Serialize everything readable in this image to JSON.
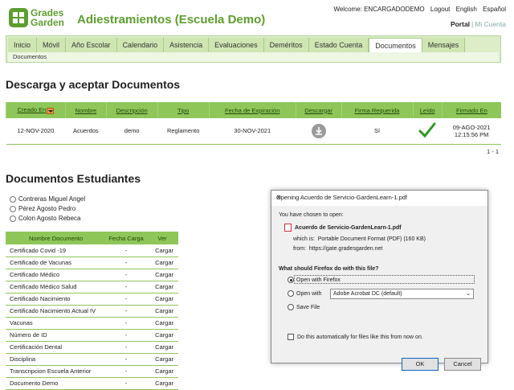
{
  "brand": {
    "line1": "Grades",
    "line2": "Garden"
  },
  "school_title": "Adiestramientos (Escuela Demo)",
  "topbar": {
    "welcome": "Welcome: ENCARGADODEMO",
    "logout": "Logout",
    "english": "English",
    "espanol": "Español",
    "portal": "Portal",
    "my_account": "Mi Cuenta"
  },
  "tabs": [
    "Inicio",
    "Móvil",
    "Año Escolar",
    "Calendario",
    "Asistencia",
    "Evaluaciones",
    "Deméritos",
    "Estado Cuenta",
    "Documentos",
    "Mensajes"
  ],
  "active_tab": "Documentos",
  "subnav": "Documentos",
  "section1_title": "Descarga y aceptar Documentos",
  "docs_table": {
    "headers": [
      "Creado En",
      "Nombre",
      "Descripción",
      "Tipo",
      "Fecha de Expiración",
      "Descargar",
      "Firma Requerida",
      "Leído",
      "Firmado En"
    ],
    "row": {
      "created": "12-NOV-2020",
      "name": "Acuerdos",
      "description": "demo",
      "type": "Reglamento",
      "expires": "30-NOV-2021",
      "required": "Sí",
      "signed_date": "09-AGO-2021",
      "signed_time": "12:15:56 PM"
    },
    "pager": "1 - 1"
  },
  "section2_title": "Documentos Estudiantes",
  "students": [
    "Contreras Miguel Angel",
    "Pérez Agosto Pedro",
    "Colon Agosto Rebeca"
  ],
  "doc_list": {
    "headers": [
      "Nombre Documento",
      "Fecha Carga",
      "Ver"
    ],
    "rows": [
      {
        "name": "Certificado Covid -19",
        "date": "-",
        "action": "Cargar"
      },
      {
        "name": "Certificado de Vacunas",
        "date": "-",
        "action": "Cargar"
      },
      {
        "name": "Certificado Médico",
        "date": "-",
        "action": "Cargar"
      },
      {
        "name": "Certificado Médico Salud",
        "date": "-",
        "action": "Cargar"
      },
      {
        "name": "Certificado Nacimiento",
        "date": "-",
        "action": "Cargar"
      },
      {
        "name": "Certificado Nacimiento Actual IV",
        "date": "-",
        "action": "Cargar"
      },
      {
        "name": "Vacunas",
        "date": "-",
        "action": "Cargar"
      },
      {
        "name": "Número de ID",
        "date": "-",
        "action": "Cargar"
      },
      {
        "name": "Certificación Dental",
        "date": "-",
        "action": "Cargar"
      },
      {
        "name": "Disciplina",
        "date": "-",
        "action": "Cargar"
      },
      {
        "name": "Transcripcion Escuela Anterior",
        "date": "-",
        "action": "Cargar"
      },
      {
        "name": "Documento Demo",
        "date": "-",
        "action": "Cargar"
      }
    ]
  },
  "dialog": {
    "title": "Opening Acuerdo de Servicio-GardenLearn-1.pdf",
    "chosen": "You have chosen to open:",
    "filename": "Acuerdo de Servicio-GardenLearn-1.pdf",
    "which_label": "which is:",
    "which_value": "Portable Document Format (PDF) (160 KB)",
    "from_label": "from:",
    "from_value": "https://gate.gradesgarden.net",
    "question": "What should Firefox do with this file?",
    "open_with_firefox": "Open with Firefox",
    "open_with": "Open with",
    "open_with_app": "Adobe Acrobat DC (default)",
    "save_file": "Save File",
    "auto_label": "Do this automatically for files like this from now on.",
    "ok": "OK",
    "cancel": "Cancel"
  },
  "colors": {
    "brand_green": "#5e9e2f",
    "table_header": "#8fc65a",
    "nav_bg": "#dcedc8",
    "check": "#2e9a1e"
  },
  "icons": [
    "download-icon",
    "check-icon",
    "pdf-icon",
    "close-icon",
    "chevron-down-icon",
    "sort-icon"
  ]
}
